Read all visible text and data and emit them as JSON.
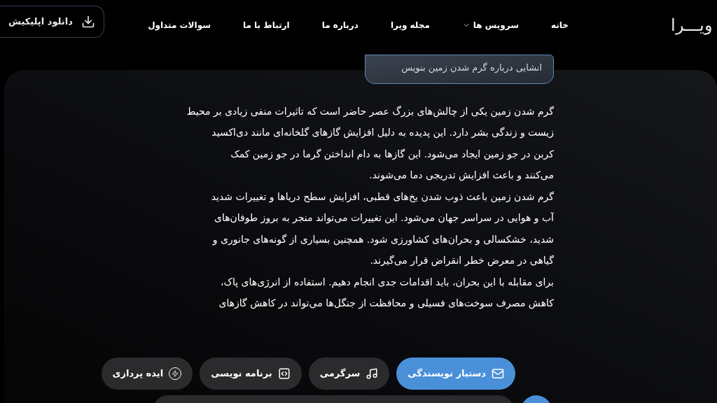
{
  "header": {
    "logo": "ویـــرا",
    "nav": [
      {
        "label": "خانه",
        "has_menu": false
      },
      {
        "label": "سرویس ها",
        "has_menu": true
      },
      {
        "label": "مجله ویرا",
        "has_menu": false
      },
      {
        "label": "درباره ما",
        "has_menu": false
      },
      {
        "label": "ارتباط با ما",
        "has_menu": false
      },
      {
        "label": "سوالات متداول",
        "has_menu": false
      }
    ],
    "download_button": "دانلود اپلیکیش"
  },
  "chat": {
    "user_message": "انشایی درباره گرم شدن زمین بنویس",
    "answer": [
      [
        "گرم شدن زمین یکی از چالش‌های بزرگ عصر حاضر است که تاثیرات منفی زیادی بر محیط",
        "زیست و زندگی بشر دارد. این پدیده به دلیل افزایش گازهای گلخانه‌ای مانند دی‌اکسید",
        "کربن در جو زمین ایجاد می‌شود. این گازها به دام انداختن گرما در جو زمین کمک",
        "می‌کنند و باعث افزایش تدریجی دما می‌شوند."
      ],
      [
        "گرم شدن زمین باعث ذوب شدن یخ‌های قطبی، افزایش سطح دریاها و تغییرات شدید",
        "آب و هوایی در سراسر جهان می‌شود. این تغییرات می‌تواند منجر به بروز طوفان‌های",
        "شدید، خشکسالی و بحران‌های کشاورزی شود. همچنین بسیاری از گونه‌های جانوری و",
        "گیاهی در معرض خطر انقراض قرار می‌گیرند."
      ],
      [
        "برای مقابله با این بحران، باید اقدامات جدی انجام دهیم. استفاده از انرژی‌های پاک،",
        "کاهش مصرف سوخت‌های فسیلی و محافظت از جنگل‌ها می‌تواند در کاهش گازهای"
      ]
    ]
  },
  "modes": [
    {
      "label": "دستیار نویسندگی",
      "selected": true
    },
    {
      "label": "سرگرمی",
      "selected": false
    },
    {
      "label": "برنامه نویسی",
      "selected": false
    },
    {
      "label": "ایده پردازی",
      "selected": false
    }
  ]
}
